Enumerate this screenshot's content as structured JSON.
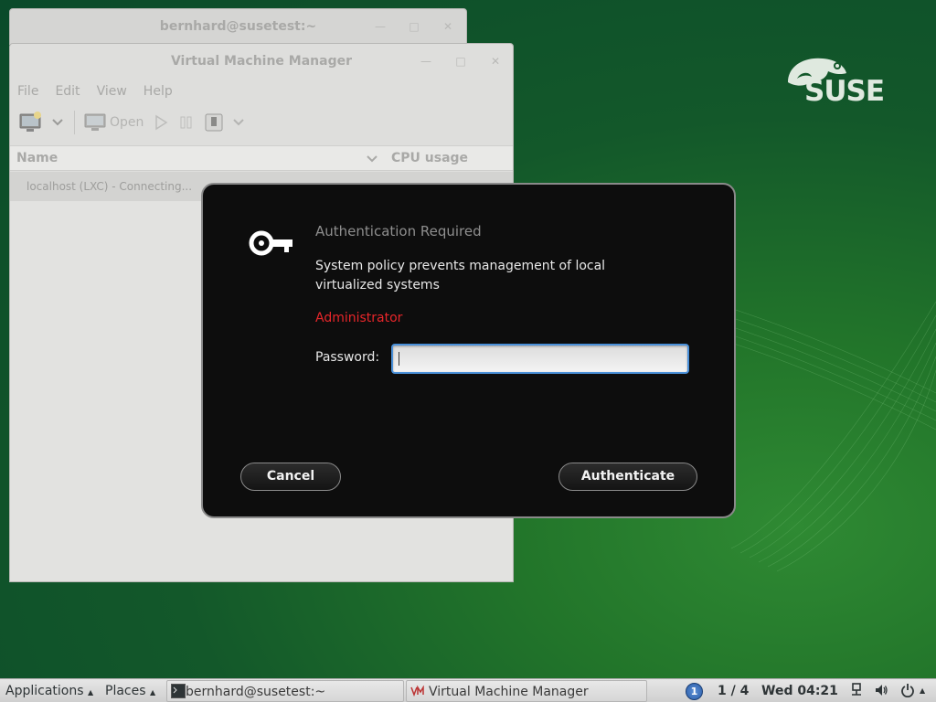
{
  "desktop": {
    "logo_text": "SUSE"
  },
  "terminal_window": {
    "title": "bernhard@susetest:~"
  },
  "vmm_window": {
    "title": "Virtual Machine Manager",
    "menu": [
      "File",
      "Edit",
      "View",
      "Help"
    ],
    "toolbar": {
      "open_label": "Open"
    },
    "columns": {
      "name": "Name",
      "cpu": "CPU usage"
    },
    "rows": [
      {
        "name": "localhost (LXC) - Connecting..."
      }
    ]
  },
  "auth_dialog": {
    "title": "Authentication Required",
    "message": "System policy prevents management of local virtualized systems",
    "user": "Administrator",
    "password_label": "Password:",
    "password_value": "",
    "cancel_label": "Cancel",
    "authenticate_label": "Authenticate",
    "user_color": "#e8262a",
    "focus_color": "#4a90d9"
  },
  "panel": {
    "applications": "Applications",
    "places": "Places",
    "tasks": [
      {
        "label": "bernhard@susetest:~",
        "icon": "terminal-icon"
      },
      {
        "label": "Virtual Machine Manager",
        "icon": "vmm-icon"
      }
    ],
    "workspace_badge": "1",
    "workspace": "1 / 4",
    "clock": "Wed 04:21"
  }
}
